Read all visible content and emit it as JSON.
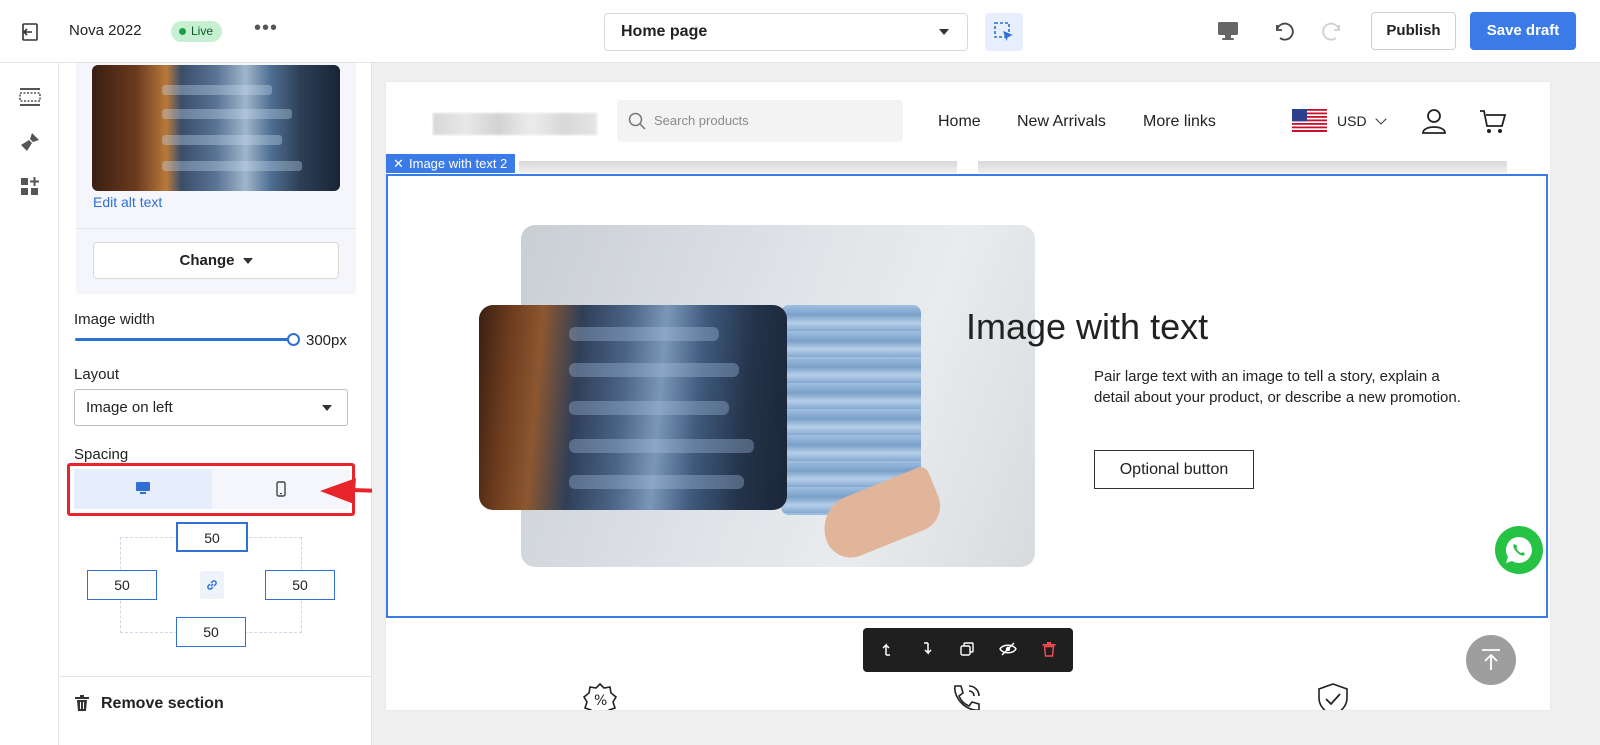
{
  "topbar": {
    "store_name": "Nova 2022",
    "status_badge": "Live",
    "more_label": "•••",
    "page_selector": "Home page",
    "publish_label": "Publish",
    "save_draft_label": "Save draft"
  },
  "panel": {
    "edit_alt_text": "Edit alt text",
    "change_label": "Change",
    "image_width_label": "Image width",
    "image_width_value": "300px",
    "layout_label": "Layout",
    "layout_value": "Image on left",
    "spacing_label": "Spacing",
    "spacing": {
      "top": "50",
      "left": "50",
      "right": "50",
      "bottom": "50"
    },
    "remove_section_label": "Remove section"
  },
  "preview": {
    "search_placeholder": "Search products",
    "nav": [
      "Home",
      "New Arrivals",
      "More links"
    ],
    "currency": "USD",
    "section_tag": "Image with text 2",
    "section_title": "Image with text",
    "section_description": "Pair large text with an image to tell a story, explain a detail about your product, or describe a new promotion.",
    "section_button": "Optional button"
  },
  "colors": {
    "accent": "#3a7be8",
    "live_badge_bg": "#c7f0d2",
    "annotation_red": "#e8252b",
    "whatsapp_green": "#26c244"
  }
}
